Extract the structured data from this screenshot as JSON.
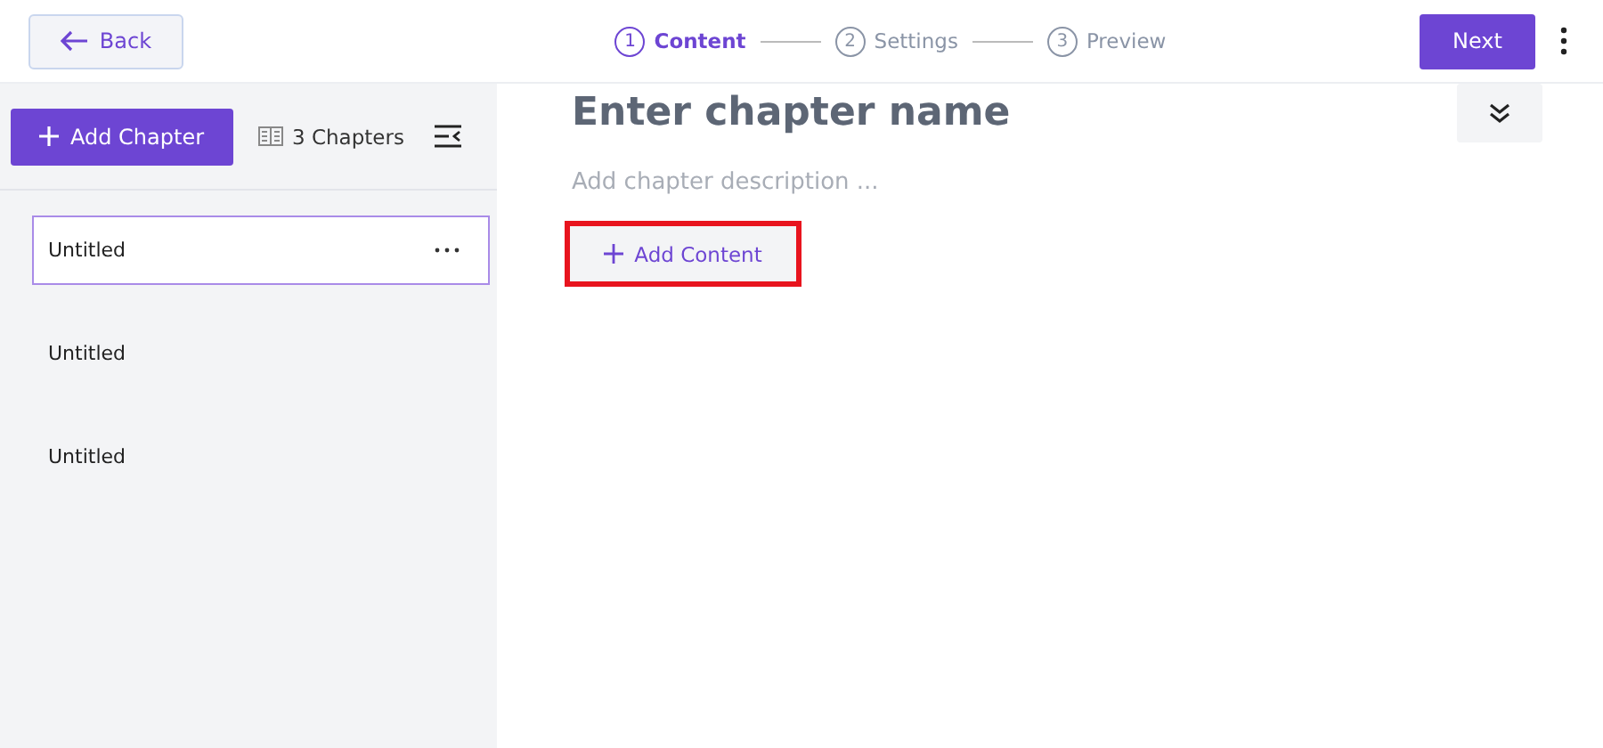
{
  "header": {
    "back_button": "Back",
    "steps": [
      {
        "number": "1",
        "label": "Content",
        "selected": true
      },
      {
        "number": "2",
        "label": "Settings",
        "selected": false
      },
      {
        "number": "3",
        "label": "Preview",
        "selected": false
      }
    ],
    "next_button": "Next"
  },
  "sidebar": {
    "add_chapter_button": "Add Chapter",
    "chapter_count": "3 Chapters",
    "chapters": [
      {
        "title": "Untitled",
        "selected": true
      },
      {
        "title": "Untitled",
        "selected": false
      },
      {
        "title": "Untitled",
        "selected": false
      }
    ]
  },
  "editor": {
    "name_placeholder": "Enter chapter name",
    "description_placeholder": "Add chapter description ...",
    "add_content_button": "Add Content",
    "highlighted": true
  }
}
